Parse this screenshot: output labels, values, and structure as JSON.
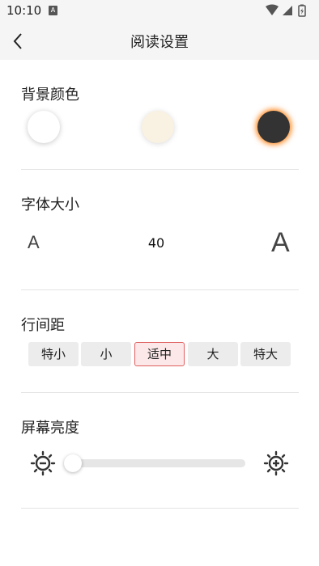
{
  "status_bar": {
    "time": "10:10",
    "notification_glyph": "A",
    "icons": [
      "notification-a-icon",
      "wifi-icon",
      "signal-icon",
      "battery-icon"
    ]
  },
  "header": {
    "back_icon": "chevron-left-icon",
    "title": "阅读设置"
  },
  "background_color": {
    "title": "背景颜色",
    "options": [
      "#ffffff",
      "#f9f1e1",
      "#333333"
    ],
    "selected_index": 2,
    "selected_ring_color": "#ff7800"
  },
  "font_size": {
    "title": "字体大小",
    "decrease_label": "A",
    "value": "40",
    "increase_label": "A"
  },
  "line_spacing": {
    "title": "行间距",
    "options": [
      "特小",
      "小",
      "适中",
      "大",
      "特大"
    ],
    "selected_index": 2,
    "selected_border_color": "#e06060"
  },
  "brightness": {
    "title": "屏幕亮度",
    "decrease_icon": "brightness-down-icon",
    "increase_icon": "brightness-up-icon",
    "level": 0
  }
}
